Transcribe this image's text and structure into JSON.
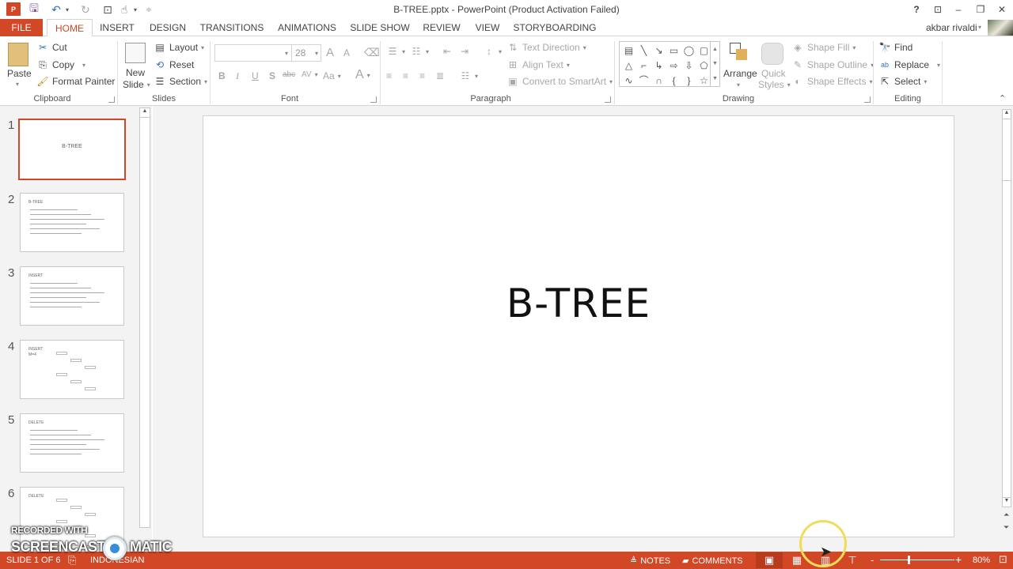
{
  "window": {
    "title": "B-TREE.pptx - PowerPoint (Product Activation Failed)",
    "app_logo": "P",
    "controls": {
      "help": "?",
      "ribbon_display": "⊡",
      "minimize": "–",
      "restore": "❐",
      "close": "✕"
    }
  },
  "quick_access": {
    "save": "save-icon",
    "undo": "undo-icon",
    "redo": "redo-icon",
    "presenter": "start-from-beginning-icon",
    "touch": "touch-mode-icon",
    "customize": "customize-qat-icon"
  },
  "tabs": [
    {
      "label": "FILE"
    },
    {
      "label": "HOME"
    },
    {
      "label": "INSERT"
    },
    {
      "label": "DESIGN"
    },
    {
      "label": "TRANSITIONS"
    },
    {
      "label": "ANIMATIONS"
    },
    {
      "label": "SLIDE SHOW"
    },
    {
      "label": "REVIEW"
    },
    {
      "label": "VIEW"
    },
    {
      "label": "STORYBOARDING"
    }
  ],
  "active_tab": "HOME",
  "user": {
    "name": "akbar rivaldi"
  },
  "ribbon": {
    "clipboard": {
      "label": "Clipboard",
      "paste": "Paste",
      "cut": "Cut",
      "copy": "Copy",
      "format_painter": "Format Painter"
    },
    "slides": {
      "label": "Slides",
      "new_slide_1": "New",
      "new_slide_2": "Slide",
      "layout": "Layout",
      "reset": "Reset",
      "section": "Section"
    },
    "font": {
      "label": "Font",
      "font_name": "",
      "font_size": "28",
      "bold": "B",
      "italic": "I",
      "underline": "U",
      "shadow": "S",
      "strike": "abc",
      "spacing": "AV",
      "case": "Aa",
      "color": "A",
      "grow": "A",
      "shrink": "A"
    },
    "paragraph": {
      "label": "Paragraph",
      "text_direction": "Text Direction",
      "align_text": "Align Text",
      "smartart": "Convert to SmartArt"
    },
    "drawing": {
      "label": "Drawing",
      "arrange": "Arrange",
      "quick_styles_1": "Quick",
      "quick_styles_2": "Styles",
      "shape_fill": "Shape Fill",
      "shape_outline": "Shape Outline",
      "shape_effects": "Shape Effects",
      "shapes": [
        "▤",
        "╲",
        "↘",
        "▭",
        "◯",
        "▢",
        "△",
        "⌐",
        "↳",
        "⇨",
        "⇩",
        "⬠",
        "∿",
        "⌒",
        "∩",
        "{",
        "}",
        "☆"
      ]
    },
    "editing": {
      "label": "Editing",
      "find": "Find",
      "replace": "Replace",
      "select": "Select"
    }
  },
  "thumbnails": [
    {
      "number": "1",
      "title": "B-TREE",
      "selected": true
    },
    {
      "number": "2",
      "title": "B-TREE"
    },
    {
      "number": "3",
      "title": "INSERT"
    },
    {
      "number": "4",
      "title": "INSERT",
      "subtitle": "M=4"
    },
    {
      "number": "5",
      "title": "DELETE"
    },
    {
      "number": "6",
      "title": "DELETE"
    }
  ],
  "slide": {
    "title": "B-TREE"
  },
  "status": {
    "slide_position": "SLIDE 1 OF 6",
    "language": "INDONESIAN",
    "notes": "NOTES",
    "comments": "COMMENTS",
    "zoom_level": "80%",
    "zoom_fraction": 0.37,
    "zoom_minus": "-",
    "zoom_plus": "+"
  },
  "watermark": {
    "line1": "RECORDED WITH",
    "line2a": "SCREENCAST",
    "line2b": "MATIC"
  }
}
